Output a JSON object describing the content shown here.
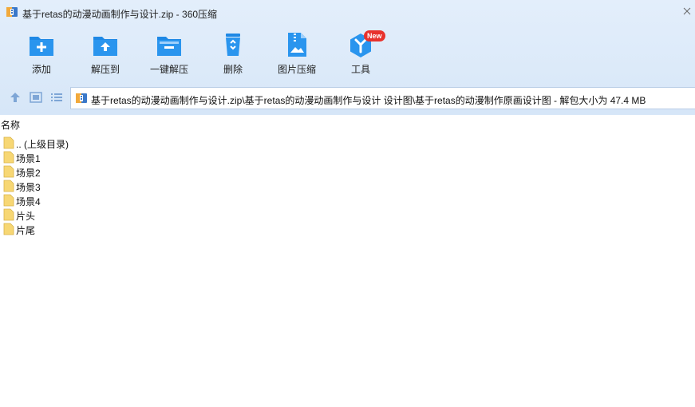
{
  "window": {
    "title": "基于retas的动漫动画制作与设计.zip - 360压缩"
  },
  "toolbar": {
    "items": [
      {
        "label": "添加",
        "icon": "add-folder-icon"
      },
      {
        "label": "解压到",
        "icon": "extract-to-icon"
      },
      {
        "label": "一键解压",
        "icon": "one-click-extract-icon"
      },
      {
        "label": "删除",
        "icon": "recycle-bin-icon"
      },
      {
        "label": "图片压缩",
        "icon": "image-compress-icon"
      },
      {
        "label": "工具",
        "icon": "tools-icon",
        "badge": "New"
      }
    ]
  },
  "navbar": {
    "path": "基于retas的动漫动画制作与设计.zip\\基于retas的动漫动画制作与设计 设计图\\基于retas的动漫制作原画设计图 - 解包大小为 47.4 MB"
  },
  "list": {
    "column_name": "名称",
    "items": [
      {
        "name": ".. (上级目录)"
      },
      {
        "name": "场景1"
      },
      {
        "name": "场景2"
      },
      {
        "name": "场景3"
      },
      {
        "name": "场景4"
      },
      {
        "name": "片头"
      },
      {
        "name": "片尾"
      }
    ]
  },
  "colors": {
    "toolbar_blue": "#1e88e5",
    "folder_yellow": "#f7d774",
    "badge_red": "#e8322d"
  }
}
